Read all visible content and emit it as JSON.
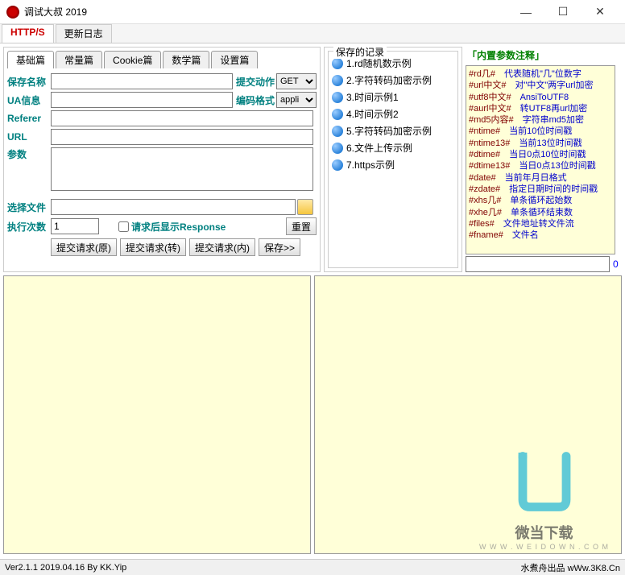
{
  "window": {
    "title": "调试大叔 2019"
  },
  "mainTabs": [
    {
      "label": "HTTP/S",
      "active": true
    },
    {
      "label": "更新日志",
      "active": false
    }
  ],
  "subTabs": [
    {
      "label": "基础篇",
      "active": true
    },
    {
      "label": "常量篇"
    },
    {
      "label": "Cookie篇"
    },
    {
      "label": "数学篇"
    },
    {
      "label": "设置篇"
    }
  ],
  "form": {
    "saveName": "保存名称",
    "uaInfo": "UA信息",
    "referer": "Referer",
    "url": "URL",
    "params": "参数",
    "submitAction": "提交动作",
    "submitActionValue": "GET",
    "encodeFormat": "编码格式",
    "encodeFormatValue": "appli",
    "selectFile": "选择文件",
    "execCount": "执行次数",
    "execCountValue": "1",
    "showResponse": "请求后显示Response",
    "resetBtn": "重置",
    "submitOrig": "提交请求(原)",
    "submitTrans": "提交请求(转)",
    "submitInner": "提交请求(内)",
    "saveBtn": "保存>>"
  },
  "records": {
    "title": "保存的记录",
    "items": [
      "1.rd随机数示例",
      "2.字符转码加密示例",
      "3.时间示例1",
      "4.时间示例2",
      "5.字符转码加密示例",
      "6.文件上传示例",
      "7.https示例"
    ]
  },
  "notes": {
    "title": "「内置参数注释」",
    "lines": [
      {
        "k": "#rd几#",
        "v": "代表随机\"几\"位数字"
      },
      {
        "k": "#url中文#",
        "v": "对\"中文\"两字url加密"
      },
      {
        "k": "#utf8中文#",
        "v": "AnsiToUTF8"
      },
      {
        "k": "#aurl中文#",
        "v": "转UTF8再url加密"
      },
      {
        "k": "#md5内容#",
        "v": "字符串md5加密"
      },
      {
        "k": "#ntime#",
        "v": "当前10位时间戳"
      },
      {
        "k": "#ntime13#",
        "v": "当前13位时间戳"
      },
      {
        "k": "#dtime#",
        "v": "当日0点10位时间戳"
      },
      {
        "k": "#dtime13#",
        "v": "当日0点13位时间戳"
      },
      {
        "k": "#date#",
        "v": "当前年月日格式"
      },
      {
        "k": "#zdate#",
        "v": "指定日期时间的时间戳"
      },
      {
        "k": "#xhs几#",
        "v": "单条循环起始数"
      },
      {
        "k": "#xhe几#",
        "v": "单条循环结束数"
      },
      {
        "k": "#files#",
        "v": "文件地址转文件流"
      },
      {
        "k": "#fname#",
        "v": "文件名"
      }
    ],
    "counter": "0"
  },
  "status": {
    "left": "Ver2.1.1 2019.04.16 By KK.Yip",
    "right": "水煮舟出品 wWw.3K8.Cn"
  },
  "watermark": {
    "text": "微当下载",
    "url": "W W W . W E I D O W N . C O M"
  }
}
